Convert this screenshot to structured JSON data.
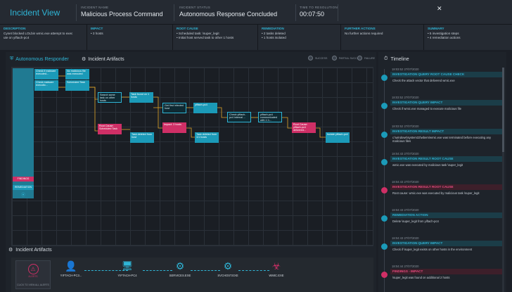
{
  "header": {
    "title": "Incident View",
    "incident_name_label": "INCIDENT NAME",
    "incident_name": "Malicious Process Command",
    "incident_status_label": "INCIDENT STATUS",
    "incident_status": "Autonomous Response Concluded",
    "ttr_label": "TIME TO RESOLUTION",
    "ttr": "00:07:50"
  },
  "summary": [
    {
      "label": "DESCRIPTION",
      "text": "Cynet blocked LOLbin wmic.exe attempt to exec\nute on yiftach-pc4"
    },
    {
      "label": "IMPACT",
      "text": "• 3 hosts"
    },
    {
      "label": "ROOT CAUSE",
      "text": "• Scheduled task: \\super_legit\n• Initial host served task to other 1 hosts"
    },
    {
      "label": "REMEDIATION",
      "text": "• 2 tasks deleted\n• 1 hosts isolated"
    },
    {
      "label": "FURTHER ACTIONS",
      "text": "No further actions required"
    },
    {
      "label": "SUMMARY",
      "text": "• 5 investigation steps\n• 4 remediation actions"
    }
  ],
  "tabs": {
    "responder": "Autonomous Responder",
    "artifacts": "Incident Artifacts"
  },
  "legend": [
    "SUCCESS",
    "PARTIAL SUCCESS",
    "FAILURE"
  ],
  "sidebar_tile": {
    "findings": "FINDINGS",
    "remediation": "REMEDIATION"
  },
  "nodes": {
    "n1": "Check if malware executed...",
    "n2": "No malicious file was executed",
    "n3": "Check malware executio...",
    "n4": "Scheduled Task",
    "n5": "Search same task on other hosts",
    "n6": "Task found on 1 hosts",
    "n7": "Get first infected host",
    "n8": "yiftach-pc4",
    "n9": "Root Cause: Scheduled Task",
    "n10": "Task deleted from host",
    "n11": "Impact: 3 hosts",
    "n12": "Task deleted from 1/1 hosts",
    "n13": "Check yiftach-pc4 internal ...",
    "n14": "yiftach-pc4 communicated with 1 h...",
    "n15": "Root Cause: yiftach-pc4 delivered...",
    "n16": "Isolate yiftach-pc4"
  },
  "artifacts": {
    "title": "Incident Artifacts",
    "alert_label": "ALERTS",
    "alert_link": "CLICK TO VIEW ALL ALERTS",
    "items": [
      "YIFTACH-PC3...",
      "YIFTACH-PC4",
      "SERVICES.EXE",
      "SVCHOST.EXE",
      "WMIC.EXE"
    ]
  },
  "timeline": {
    "title": "Timeline",
    "items": [
      {
        "ts": "18:03:52 27/07/2020",
        "head": "INVESTIGATION QUERY ROOT CAUSE CHECK",
        "body": "Check the attack vector that delivered wmic.exe",
        "color": "teal"
      },
      {
        "ts": "18:03:52 27/07/2020",
        "head": "INVESTIGATION QUERY IMPACT",
        "body": "Check if wmic.exe managed to execute malicious file",
        "color": "teal"
      },
      {
        "ts": "18:03:52 27/07/2020",
        "head": "INVESTIGATION RESULT IMPACT",
        "body": "c:\\windows\\system32\\wbem\\wmic.exe was terminated before executing any malicious files",
        "color": "teal"
      },
      {
        "ts": "18:04:43 27/07/2020",
        "head": "INVESTIGATION RESULT ROOT CAUSE",
        "body": "wmic.exe was executed by malicious task \\super_legit",
        "color": "teal"
      },
      {
        "ts": "18:04:43 27/07/2020",
        "head": "INVESTIGATION RESULT ROOT CAUSE",
        "body": "Root cause: wmic.exe was executed by malicious task \\super_legit",
        "color": "pink"
      },
      {
        "ts": "18:04:43 27/07/2020",
        "head": "REMEDIATION ACTION",
        "body": "Delete \\super_legit from yiftach-pc4",
        "color": "teal"
      },
      {
        "ts": "18:04:43 27/07/2020",
        "head": "INVESTIGATION QUERY IMPACT",
        "body": "Check if \\super_legit exists on other hosts in the environment",
        "color": "teal"
      },
      {
        "ts": "18:04:44 27/07/2020",
        "head": "FINDINGS - IMPACT",
        "body": "\\super_legit was found on additional 2 hosts",
        "color": "pink"
      }
    ]
  },
  "colors": {
    "accent": "#2fb5d6",
    "alert": "#cf2f66",
    "bg": "#1b1f26"
  }
}
